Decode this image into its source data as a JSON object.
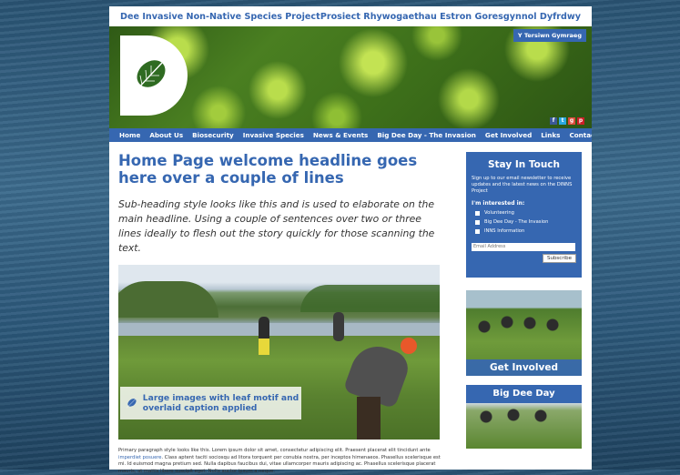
{
  "header": {
    "left_title": "Dee Invasive Non-Native Species Project",
    "right_title": "Prosiect Rhywogaethau Estron Goresgynnol Dyfrdwy",
    "welsh_button": "Y Tersiwn Gymraeg"
  },
  "nav": {
    "items": [
      "Home",
      "About Us",
      "Biosecurity",
      "Invasive Species",
      "News & Events",
      "Big Dee Day - The Invasion",
      "Get Involved",
      "Links",
      "Contact Us"
    ]
  },
  "main": {
    "headline": "Home Page welcome headline goes here over a couple of lines",
    "subheading": "Sub-heading style looks like this and is used to elaborate on the main headline. Using a couple of sentences over two or three lines ideally to flesh out the story quickly for those scanning the text.",
    "caption": "Large images with leaf motif and overlaid caption applied",
    "body_pre": "Primary paragraph style looks like this. Lorem ipsum dolor sit amet, consectetur adipiscing elit. Praesent placerat elit tincidunt ante ",
    "body_link": "imperdiet posuere",
    "body_post": ". Class aptent taciti sociosqu ad litora torquent per conubia nostra, per inceptos himenaeos. Phasellus scelerisque est mi. Id euismod magna pretium sed. Nulla dapibus faucibus dui, vitae ullamcorper mauris adipiscing ac. Phasellus scelerisque placerat mauris, at mattis libero suscipit eget. Nulla auctor ipsum a neque."
  },
  "sidebar": {
    "stay_title": "Stay In Touch",
    "stay_desc": "Sign up to our email newsletter to receive updates and the latest news on the DINNS Project",
    "interest_label": "I'm interested in:",
    "options": [
      "Volunteering",
      "Big Dee Day - The Invasion",
      "INNS Information"
    ],
    "email_placeholder": "Email Address",
    "subscribe_label": "Subscribe",
    "get_involved": "Get Involved",
    "big_dee_day": "Big Dee Day"
  }
}
